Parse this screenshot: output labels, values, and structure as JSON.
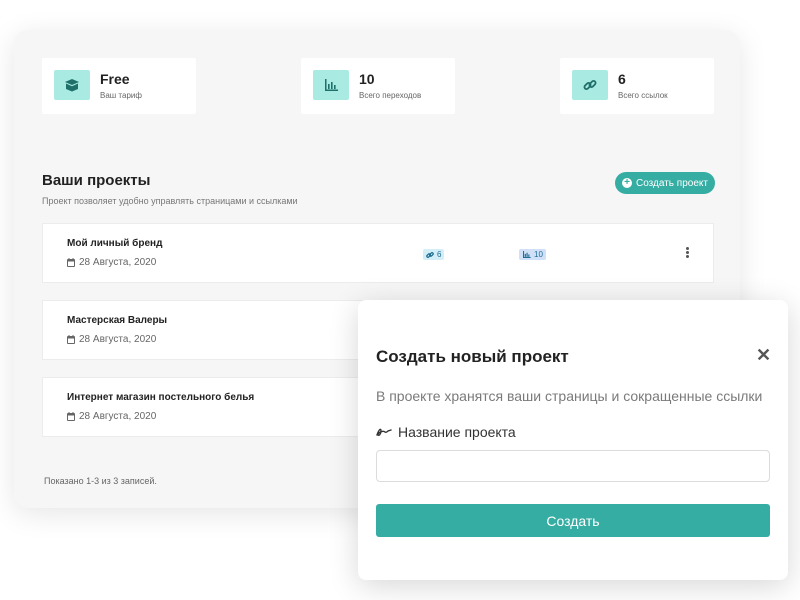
{
  "colors": {
    "accent": "#36ada3",
    "icon_bg": "#a9ebe2"
  },
  "stats": [
    {
      "icon": "box-icon",
      "value": "Free",
      "label": "Ваш тариф"
    },
    {
      "icon": "bar-chart-icon",
      "value": "10",
      "label": "Всего переходов"
    },
    {
      "icon": "link-icon",
      "value": "6",
      "label": "Всего ссылок"
    }
  ],
  "projects_section": {
    "title": "Ваши проекты",
    "subtitle": "Проект позволяет удобно управлять страницами и ссылками",
    "create_button": "Создать проект"
  },
  "projects": [
    {
      "name": "Мой личный бренд",
      "date": "28 Августа, 2020",
      "links": "6",
      "clicks": "10"
    },
    {
      "name": "Мастерская Валеры",
      "date": "28 Августа, 2020"
    },
    {
      "name": "Интернет магазин постельного белья",
      "date": "28 Августа, 2020"
    }
  ],
  "footer": {
    "summary": "Показано 1-3 из 3 записей."
  },
  "modal": {
    "title": "Создать новый проект",
    "close": "✕",
    "description": "В проекте хранятся ваши страницы и сокращенные ссылки",
    "field_label": "Название проекта",
    "field_value": "",
    "submit": "Создать"
  }
}
